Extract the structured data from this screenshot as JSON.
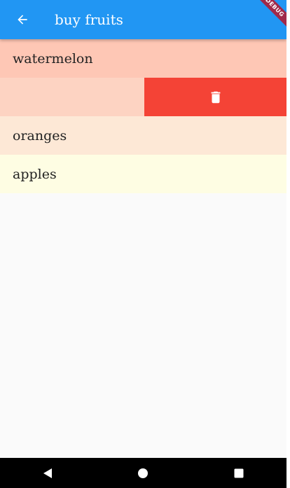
{
  "app_bar": {
    "title": "buy fruits",
    "back_icon": "arrow-back-icon",
    "color": "#2196f3"
  },
  "debug_banner": {
    "label": "DEBUG"
  },
  "list": {
    "items": [
      {
        "label": "watermelon",
        "color": "#fec7b5"
      },
      {
        "label": "",
        "color": "#fdd3c2",
        "swiped": true,
        "action_icon": "trash-icon",
        "action_color": "#f44336"
      },
      {
        "label": "oranges",
        "color": "#fde8d6"
      },
      {
        "label": "apples",
        "color": "#fefde3"
      }
    ]
  },
  "nav_bar": {
    "back_icon": "triangle-back-icon",
    "home_icon": "circle-home-icon",
    "recents_icon": "square-recents-icon"
  }
}
